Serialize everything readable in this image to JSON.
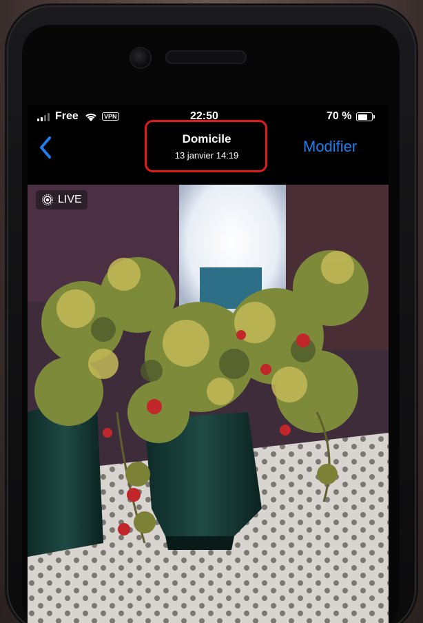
{
  "status_bar": {
    "carrier": "Free",
    "vpn_label": "VPN",
    "time": "22:50",
    "battery_text": "70 %",
    "battery_level_pct": 70,
    "signal_bars_active": 2,
    "signal_bars_total": 4
  },
  "nav": {
    "back_icon": "chevron-left-icon",
    "title": "Domicile",
    "subtitle": "13 janvier  14:19",
    "edit_label": "Modifier"
  },
  "photo": {
    "live_label": "LIVE",
    "live_icon": "live-photo-icon"
  },
  "colors": {
    "accent": "#1e7ff0",
    "highlight_box": "#e21a1a"
  }
}
